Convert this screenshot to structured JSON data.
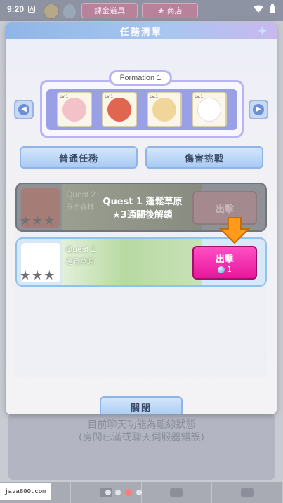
{
  "status_bar": {
    "time": "9:20",
    "indicator": "A"
  },
  "background": {
    "top_buttons": [
      "課金道具",
      "★ 商店"
    ],
    "chat_error_line1": "目前聊天功能為離線狀態",
    "chat_error_line2": "(房間已滿或聊天伺服器錯誤)",
    "watermark": "java800.com"
  },
  "modal": {
    "title": "任務清單",
    "formation_label": "Formation 1",
    "formation_slots": [
      {
        "level": "Lv.1",
        "icon": "cat-girl-portrait-icon",
        "color": "#f3c1c8"
      },
      {
        "level": "Lv.1",
        "icon": "red-dragon-portrait-icon",
        "color": "#e0664f"
      },
      {
        "level": "Lv.1",
        "icon": "cat-girl-blonde-portrait-icon",
        "color": "#f1d69b"
      },
      {
        "level": "Lv.1",
        "icon": "white-cat-portrait-icon",
        "color": "#ffffff"
      }
    ],
    "tabs": [
      "普通任務",
      "傷害挑戰"
    ],
    "quests": [
      {
        "title": "Quest 2",
        "subtitle": "茂密森林",
        "locked": true,
        "lock_line1": "Quest 1 蓬鬆草原",
        "lock_line2": "★3通關後解鎖",
        "go_label": "出擊"
      },
      {
        "title": "Quest 1",
        "subtitle": "蓬鬆草原",
        "locked": false,
        "go_label": "出擊",
        "cost": "1"
      }
    ],
    "close_label": "關閉"
  },
  "colors": {
    "accent_pink": "#e8169b",
    "header_blue": "#8fb6e8",
    "pointer_orange": "#ff9a1a"
  }
}
